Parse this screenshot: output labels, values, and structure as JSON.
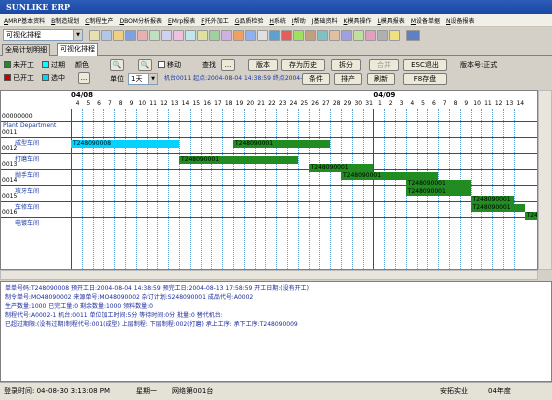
{
  "window": {
    "title": "SUNLIKE ERP"
  },
  "menu": [
    {
      "key": "A",
      "label": "MRP基本资料"
    },
    {
      "key": "B",
      "label": "制造规划"
    },
    {
      "key": "C",
      "label": "制程生产"
    },
    {
      "key": "D",
      "label": "BOM分析报表"
    },
    {
      "key": "E",
      "label": "Mrp报表"
    },
    {
      "key": "F",
      "label": "托外加工"
    },
    {
      "key": "G",
      "label": "品质检验"
    },
    {
      "key": "H",
      "label": "系统"
    },
    {
      "key": "I",
      "label": "帮助"
    },
    {
      "key": "J",
      "label": "基础资料"
    },
    {
      "key": "K",
      "label": "模具操作"
    },
    {
      "key": "L",
      "label": "模具报表"
    },
    {
      "key": "M",
      "label": "设备单据"
    },
    {
      "key": "N",
      "label": "设备报表"
    }
  ],
  "toolbar": {
    "view_select": "可视化排程"
  },
  "tabs": [
    {
      "label": "全局计划明细"
    },
    {
      "label": "可视化排程"
    }
  ],
  "legend": {
    "not_started": "未开工",
    "overdue": "过期",
    "started": "已开工",
    "selected": "选中",
    "color": "颜色",
    "colors": {
      "not_started": "#228b22",
      "overdue": "#00ffff",
      "started": "#cc0000",
      "selected": "#00d4ff"
    }
  },
  "controls": {
    "move_label": "移动",
    "search_label": "查找",
    "search_btn": "...",
    "unit_label": "单位",
    "unit_value": "1天",
    "machine_info": "机台0011 起点:2004-08-04 14:38:59 终点2004-08",
    "version_btn": "版本",
    "save_history_btn": "存为历史",
    "split_btn": "拆分",
    "merge_btn": "合并",
    "esc_btn": "ESC退出",
    "version_no": "版本号:正式",
    "condition_btn": "条件",
    "schedule_btn": "排产",
    "refresh_btn": "刷新",
    "f8_btn": "F8存盘"
  },
  "gantt": {
    "month1": "04/08",
    "month2": "04/09",
    "days": [
      "4",
      "5",
      "6",
      "7",
      "8",
      "9",
      "10",
      "11",
      "12",
      "13",
      "14",
      "15",
      "16",
      "17",
      "18",
      "19",
      "20",
      "21",
      "22",
      "23",
      "24",
      "25",
      "26",
      "27",
      "28",
      "29",
      "30",
      "31",
      "1",
      "2",
      "3",
      "4",
      "5",
      "6",
      "7",
      "8",
      "9",
      "10",
      "11",
      "12",
      "13",
      "14"
    ],
    "rows": [
      {
        "code": "00000000",
        "dept": "Plant Department"
      },
      {
        "code": "0011",
        "dept": "成型车间"
      },
      {
        "code": "0012",
        "dept": "打磨车间"
      },
      {
        "code": "0013",
        "dept": "抛手车间"
      },
      {
        "code": "0014",
        "dept": "攻牙车间"
      },
      {
        "code": "0015",
        "dept": "车修车间"
      },
      {
        "code": "0016",
        "dept": "电镀车间"
      }
    ],
    "bars": [
      {
        "label": "T248090008",
        "row": 1,
        "start": 0,
        "end": 10,
        "status": "selected"
      },
      {
        "label": "T248090001",
        "row": 1,
        "start": 15,
        "end": 24,
        "status": "not_started"
      },
      {
        "label": "T248090001",
        "row": 2,
        "start": 10,
        "end": 21,
        "status": "not_started"
      },
      {
        "label": "T248090001",
        "row": 2.5,
        "start": 22,
        "end": 28,
        "status": "not_started"
      },
      {
        "label": "T248090001",
        "row": 3,
        "start": 25,
        "end": 34,
        "status": "not_started"
      },
      {
        "label": "T248090001",
        "row": 3.5,
        "start": 31,
        "end": 37,
        "status": "not_started"
      },
      {
        "label": "T248090001",
        "row": 4,
        "start": 31,
        "end": 37,
        "status": "not_started"
      },
      {
        "label": "T248090001",
        "row": 4.5,
        "start": 37,
        "end": 41,
        "status": "not_started"
      },
      {
        "label": "T248090001",
        "row": 5,
        "start": 37,
        "end": 42,
        "status": "not_started"
      },
      {
        "label": "T248090001",
        "row": 5.5,
        "start": 42,
        "end": 44,
        "status": "not_started"
      }
    ]
  },
  "info": [
    "单单号码:T248090008  预开工日:2004-08-04 14:38:59  预完工日:2004-08-13 17:58:59  开工日期:(没有开工)",
    "制令单号:MO48090002  来源单号:MO48090002  杂订计划:S248090001  成品代号:A0002",
    "生产数量:1000  已完工量:0  剩余数量:1000  领料数量:0",
    "制程代号:A0002-1  机台:0011  单位加工时间:5分  等待时间:0分  批量:0  替代机台:",
    "已超过期限:(没有过期)制程代号:001(成型)  上层制程:  下层制程:002(打磨)  承上工序:  承下工序:T248090009"
  ],
  "status": {
    "login": "登录时间: 04-08-30 3:13:08 PM",
    "weekday": "星期一",
    "network": "网络第001台",
    "company": "安拓实业",
    "year": "04年度"
  }
}
